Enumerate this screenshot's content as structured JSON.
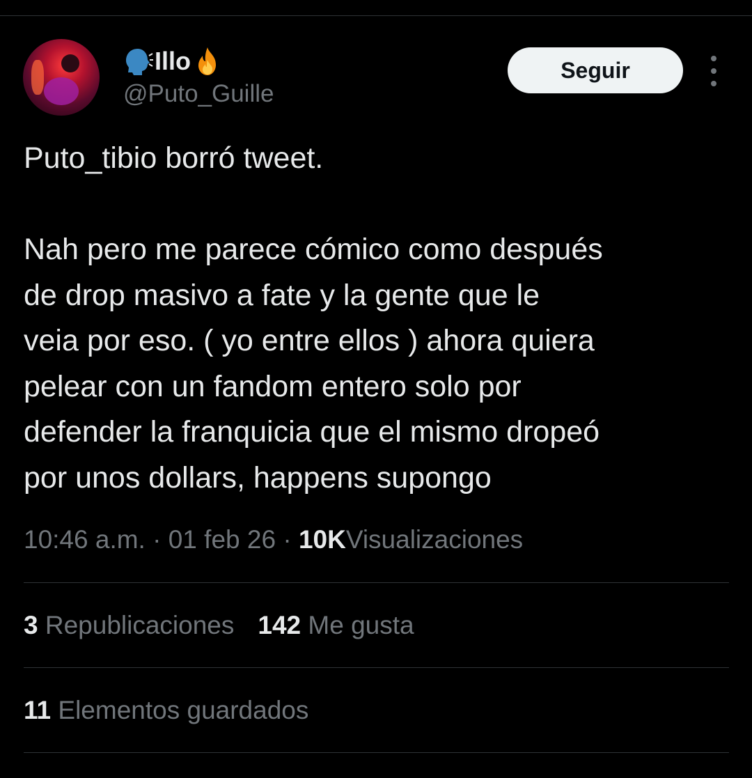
{
  "user": {
    "display_name": "Illo",
    "handle": "@Puto_Guille",
    "name_emoji_left": "speaking-head-icon",
    "name_emoji_right": "fire-icon"
  },
  "follow_button_label": "Seguir",
  "tweet": {
    "lines": [
      "Puto_tibio borró tweet.",
      "",
      "Nah pero me parece cómico como después",
      "de drop masivo a fate y la gente que le",
      "veia por eso. ( yo entre ellos ) ahora quiera",
      "pelear con un fandom entero solo por",
      "defender la franquicia que el mismo dropeó",
      "por unos dollars, happens supongo"
    ]
  },
  "meta": {
    "time": "10:46 a.m.",
    "separator": "·",
    "date": "01 feb 26",
    "views_count": "10K",
    "views_label": "Visualizaciones"
  },
  "stats": {
    "reposts_count": "3",
    "reposts_label": "Republicaciones",
    "likes_count": "142",
    "likes_label": "Me gusta",
    "bookmarks_count": "11",
    "bookmarks_label": "Elementos guardados"
  },
  "colors": {
    "background": "#000000",
    "text_primary": "#e7e9ea",
    "text_secondary": "#71767b",
    "divider": "#2f3336",
    "button_bg": "#eff3f4"
  }
}
